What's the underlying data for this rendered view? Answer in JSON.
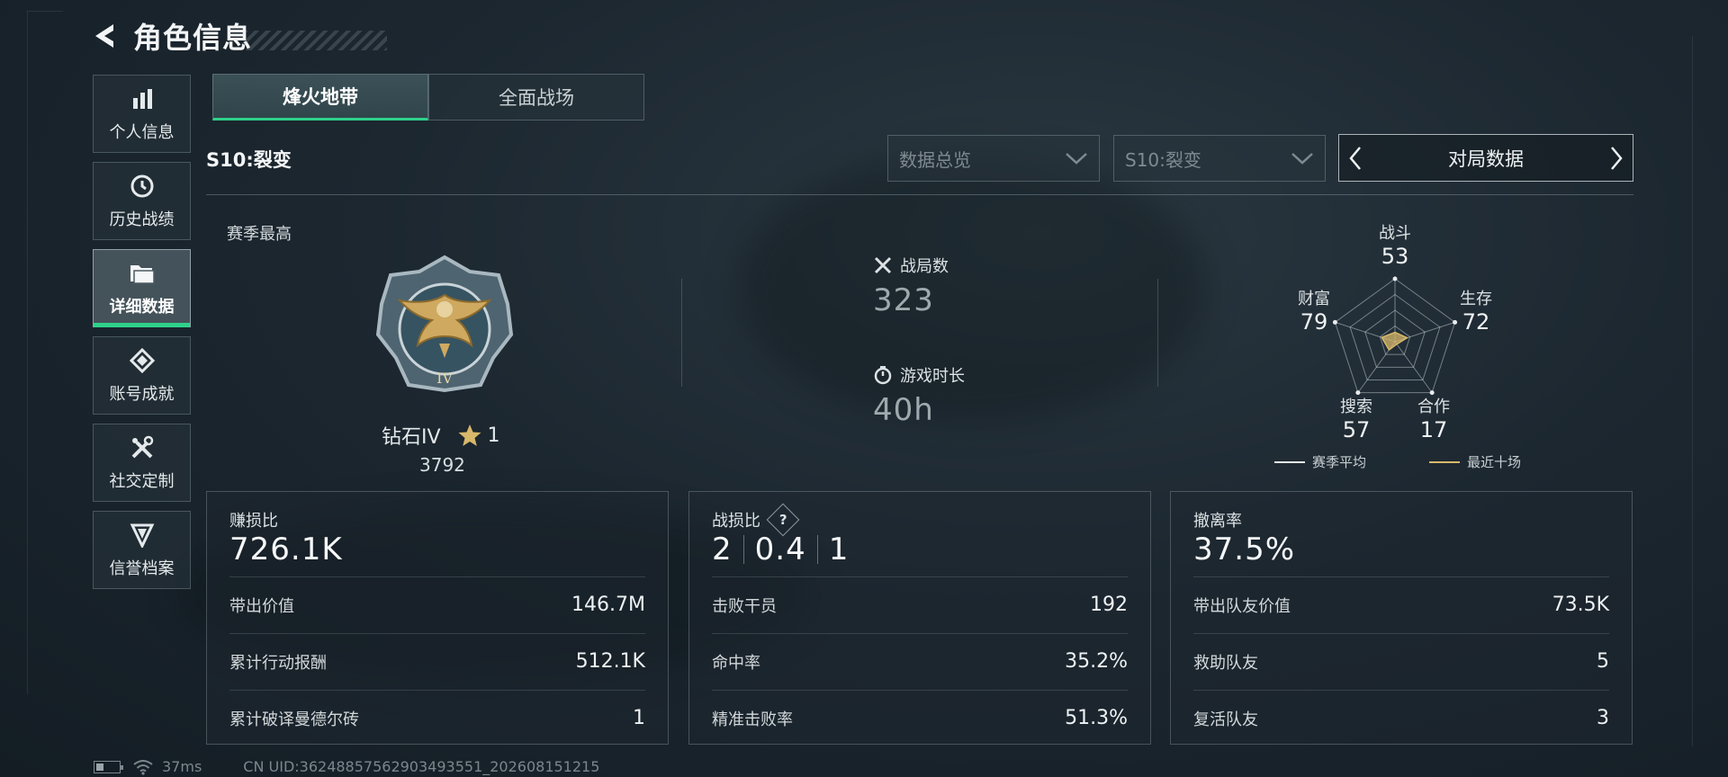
{
  "header": {
    "title": "角色信息"
  },
  "sidebar": {
    "items": [
      {
        "label": "个人信息",
        "icon": "bar-chart-icon"
      },
      {
        "label": "历史战绩",
        "icon": "history-icon"
      },
      {
        "label": "详细数据",
        "icon": "folder-icon",
        "active": true
      },
      {
        "label": "账号成就",
        "icon": "achievement-icon"
      },
      {
        "label": "社交定制",
        "icon": "tools-icon"
      },
      {
        "label": "信誉档案",
        "icon": "shield-icon"
      }
    ]
  },
  "tabs": [
    {
      "label": "烽火地带",
      "active": true
    },
    {
      "label": "全面战场",
      "active": false
    }
  ],
  "season": {
    "label": "S10:裂变"
  },
  "filters": {
    "data_dropdown": "数据总览",
    "season_dropdown": "S10:裂变",
    "pager_label": "对局数据"
  },
  "season_best": {
    "title": "赛季最高",
    "rank": "钻石IV",
    "stars": "1",
    "score": "3792",
    "medal_numeral": "IV"
  },
  "overview": {
    "matches_label": "战局数",
    "matches_value": "323",
    "playtime_label": "游戏时长",
    "playtime_value": "40h"
  },
  "radar": {
    "axes": [
      {
        "name": "战斗",
        "value": "53"
      },
      {
        "name": "生存",
        "value": "72"
      },
      {
        "name": "合作",
        "value": "17"
      },
      {
        "name": "搜索",
        "value": "57"
      },
      {
        "name": "财富",
        "value": "79"
      }
    ],
    "legend_avg": "赛季平均",
    "legend_recent": "最近十场",
    "avg_color": "#e8ecee",
    "recent_color": "#d8b86a"
  },
  "cards": {
    "profit": {
      "title": "赚损比",
      "value": "726.1K",
      "rows": [
        {
          "k": "带出价值",
          "v": "146.7M"
        },
        {
          "k": "累计行动报酬",
          "v": "512.1K"
        },
        {
          "k": "累计破译曼德尔砖",
          "v": "1"
        }
      ]
    },
    "kd": {
      "title": "战损比",
      "help": "?",
      "parts": [
        "2",
        "0.4",
        "1"
      ],
      "rows": [
        {
          "k": "击败干员",
          "v": "192"
        },
        {
          "k": "命中率",
          "v": "35.2%"
        },
        {
          "k": "精准击败率",
          "v": "51.3%"
        }
      ]
    },
    "extract": {
      "title": "撤离率",
      "value": "37.5%",
      "rows": [
        {
          "k": "带出队友价值",
          "v": "73.5K"
        },
        {
          "k": "救助队友",
          "v": "5"
        },
        {
          "k": "复活队友",
          "v": "3"
        }
      ]
    }
  },
  "footer": {
    "ping": "37ms",
    "uid": "CN UID:36248857562903493551_202608151215"
  },
  "colors": {
    "accent": "#2fd18a",
    "gold": "#d8b86a"
  }
}
